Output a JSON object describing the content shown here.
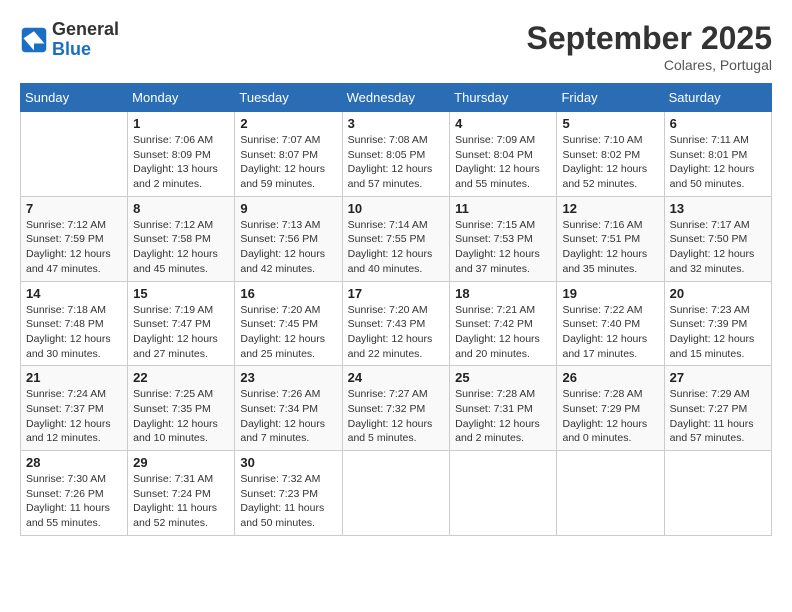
{
  "header": {
    "logo_general": "General",
    "logo_blue": "Blue",
    "month_title": "September 2025",
    "location": "Colares, Portugal"
  },
  "weekdays": [
    "Sunday",
    "Monday",
    "Tuesday",
    "Wednesday",
    "Thursday",
    "Friday",
    "Saturday"
  ],
  "weeks": [
    [
      {
        "day": "",
        "info": ""
      },
      {
        "day": "1",
        "info": "Sunrise: 7:06 AM\nSunset: 8:09 PM\nDaylight: 13 hours\nand 2 minutes."
      },
      {
        "day": "2",
        "info": "Sunrise: 7:07 AM\nSunset: 8:07 PM\nDaylight: 12 hours\nand 59 minutes."
      },
      {
        "day": "3",
        "info": "Sunrise: 7:08 AM\nSunset: 8:05 PM\nDaylight: 12 hours\nand 57 minutes."
      },
      {
        "day": "4",
        "info": "Sunrise: 7:09 AM\nSunset: 8:04 PM\nDaylight: 12 hours\nand 55 minutes."
      },
      {
        "day": "5",
        "info": "Sunrise: 7:10 AM\nSunset: 8:02 PM\nDaylight: 12 hours\nand 52 minutes."
      },
      {
        "day": "6",
        "info": "Sunrise: 7:11 AM\nSunset: 8:01 PM\nDaylight: 12 hours\nand 50 minutes."
      }
    ],
    [
      {
        "day": "7",
        "info": "Sunrise: 7:12 AM\nSunset: 7:59 PM\nDaylight: 12 hours\nand 47 minutes."
      },
      {
        "day": "8",
        "info": "Sunrise: 7:12 AM\nSunset: 7:58 PM\nDaylight: 12 hours\nand 45 minutes."
      },
      {
        "day": "9",
        "info": "Sunrise: 7:13 AM\nSunset: 7:56 PM\nDaylight: 12 hours\nand 42 minutes."
      },
      {
        "day": "10",
        "info": "Sunrise: 7:14 AM\nSunset: 7:55 PM\nDaylight: 12 hours\nand 40 minutes."
      },
      {
        "day": "11",
        "info": "Sunrise: 7:15 AM\nSunset: 7:53 PM\nDaylight: 12 hours\nand 37 minutes."
      },
      {
        "day": "12",
        "info": "Sunrise: 7:16 AM\nSunset: 7:51 PM\nDaylight: 12 hours\nand 35 minutes."
      },
      {
        "day": "13",
        "info": "Sunrise: 7:17 AM\nSunset: 7:50 PM\nDaylight: 12 hours\nand 32 minutes."
      }
    ],
    [
      {
        "day": "14",
        "info": "Sunrise: 7:18 AM\nSunset: 7:48 PM\nDaylight: 12 hours\nand 30 minutes."
      },
      {
        "day": "15",
        "info": "Sunrise: 7:19 AM\nSunset: 7:47 PM\nDaylight: 12 hours\nand 27 minutes."
      },
      {
        "day": "16",
        "info": "Sunrise: 7:20 AM\nSunset: 7:45 PM\nDaylight: 12 hours\nand 25 minutes."
      },
      {
        "day": "17",
        "info": "Sunrise: 7:20 AM\nSunset: 7:43 PM\nDaylight: 12 hours\nand 22 minutes."
      },
      {
        "day": "18",
        "info": "Sunrise: 7:21 AM\nSunset: 7:42 PM\nDaylight: 12 hours\nand 20 minutes."
      },
      {
        "day": "19",
        "info": "Sunrise: 7:22 AM\nSunset: 7:40 PM\nDaylight: 12 hours\nand 17 minutes."
      },
      {
        "day": "20",
        "info": "Sunrise: 7:23 AM\nSunset: 7:39 PM\nDaylight: 12 hours\nand 15 minutes."
      }
    ],
    [
      {
        "day": "21",
        "info": "Sunrise: 7:24 AM\nSunset: 7:37 PM\nDaylight: 12 hours\nand 12 minutes."
      },
      {
        "day": "22",
        "info": "Sunrise: 7:25 AM\nSunset: 7:35 PM\nDaylight: 12 hours\nand 10 minutes."
      },
      {
        "day": "23",
        "info": "Sunrise: 7:26 AM\nSunset: 7:34 PM\nDaylight: 12 hours\nand 7 minutes."
      },
      {
        "day": "24",
        "info": "Sunrise: 7:27 AM\nSunset: 7:32 PM\nDaylight: 12 hours\nand 5 minutes."
      },
      {
        "day": "25",
        "info": "Sunrise: 7:28 AM\nSunset: 7:31 PM\nDaylight: 12 hours\nand 2 minutes."
      },
      {
        "day": "26",
        "info": "Sunrise: 7:28 AM\nSunset: 7:29 PM\nDaylight: 12 hours\nand 0 minutes."
      },
      {
        "day": "27",
        "info": "Sunrise: 7:29 AM\nSunset: 7:27 PM\nDaylight: 11 hours\nand 57 minutes."
      }
    ],
    [
      {
        "day": "28",
        "info": "Sunrise: 7:30 AM\nSunset: 7:26 PM\nDaylight: 11 hours\nand 55 minutes."
      },
      {
        "day": "29",
        "info": "Sunrise: 7:31 AM\nSunset: 7:24 PM\nDaylight: 11 hours\nand 52 minutes."
      },
      {
        "day": "30",
        "info": "Sunrise: 7:32 AM\nSunset: 7:23 PM\nDaylight: 11 hours\nand 50 minutes."
      },
      {
        "day": "",
        "info": ""
      },
      {
        "day": "",
        "info": ""
      },
      {
        "day": "",
        "info": ""
      },
      {
        "day": "",
        "info": ""
      }
    ]
  ]
}
